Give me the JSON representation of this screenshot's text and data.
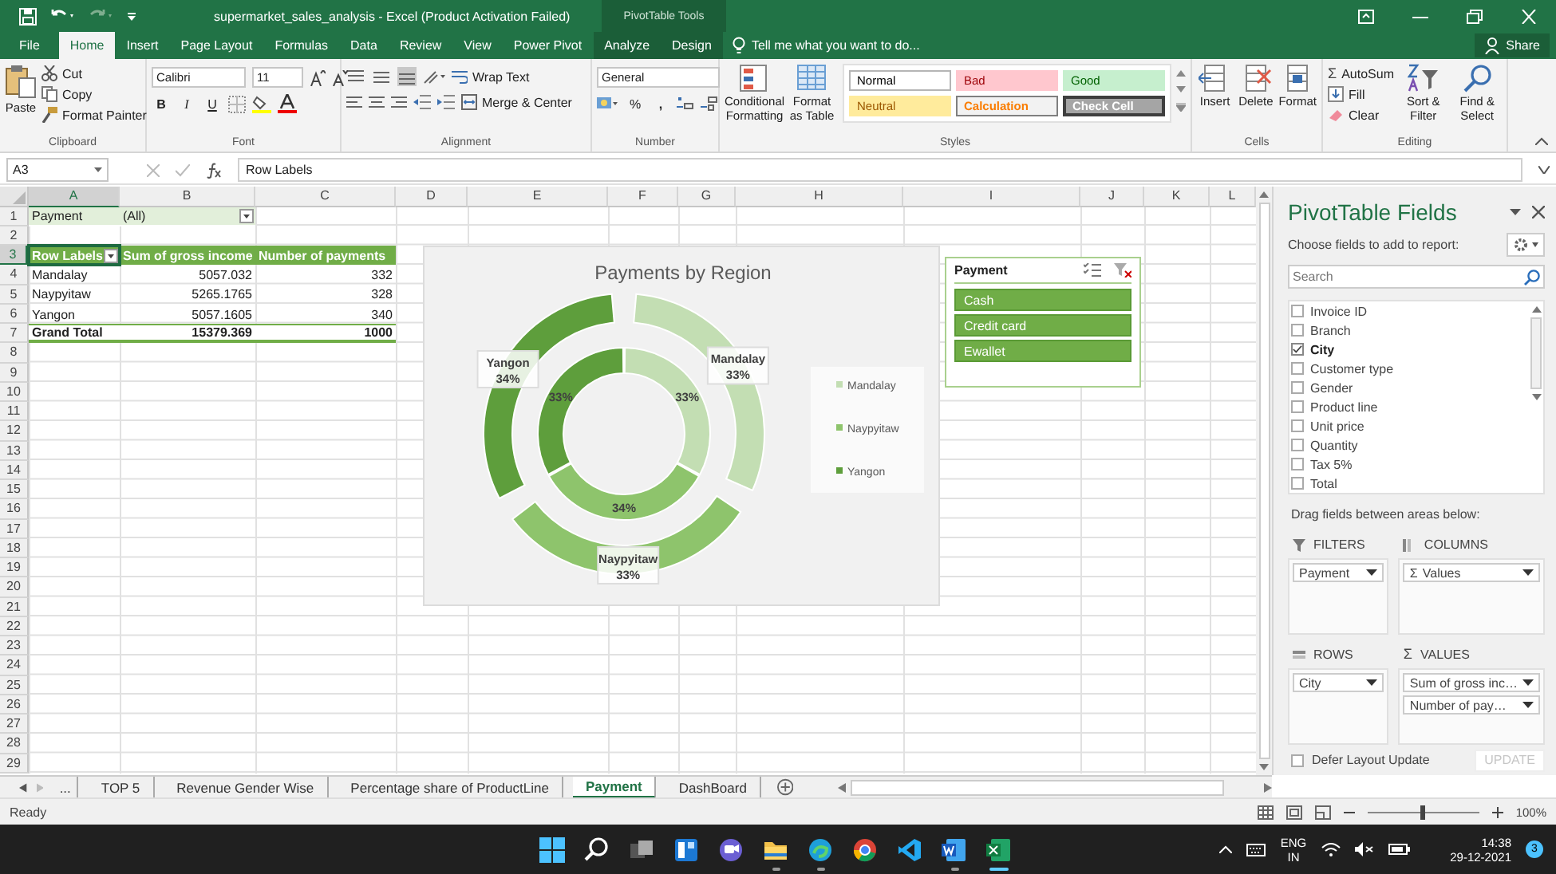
{
  "window": {
    "title": "supermarket_sales_analysis - Excel (Product Activation Failed)",
    "context_group": "PivotTable Tools"
  },
  "tabs": [
    {
      "label": "File",
      "selected": false,
      "contextual": false
    },
    {
      "label": "Home",
      "selected": true,
      "contextual": false
    },
    {
      "label": "Insert",
      "selected": false,
      "contextual": false
    },
    {
      "label": "Page Layout",
      "selected": false,
      "contextual": false
    },
    {
      "label": "Formulas",
      "selected": false,
      "contextual": false
    },
    {
      "label": "Data",
      "selected": false,
      "contextual": false
    },
    {
      "label": "Review",
      "selected": false,
      "contextual": false
    },
    {
      "label": "View",
      "selected": false,
      "contextual": false
    },
    {
      "label": "Power Pivot",
      "selected": false,
      "contextual": false
    },
    {
      "label": "Analyze",
      "selected": false,
      "contextual": true
    },
    {
      "label": "Design",
      "selected": false,
      "contextual": true
    }
  ],
  "tell_me": {
    "placeholder": "Tell me what you want to do..."
  },
  "share": "Share",
  "ribbon": {
    "clipboard": {
      "label": "Clipboard",
      "paste": "Paste",
      "cut": "Cut",
      "copy": "Copy",
      "format_painter": "Format Painter"
    },
    "font": {
      "label": "Font",
      "name": "Calibri",
      "size": "11",
      "bold": "B",
      "italic": "I",
      "underline": "U"
    },
    "alignment": {
      "label": "Alignment",
      "wrap_text": "Wrap Text",
      "merge_center": "Merge & Center",
      "vertical_align": [
        {
          "selected": false
        },
        {
          "selected": false
        },
        {
          "selected": true
        }
      ]
    },
    "number": {
      "label": "Number",
      "format": "General",
      "percent": "%",
      "comma": ","
    },
    "styles": {
      "label": "Styles",
      "conditional_formatting": "Conditional Formatting",
      "format_as_table": "Format as Table",
      "cell_styles": [
        {
          "label": "Normal",
          "kind": "normal"
        },
        {
          "label": "Bad",
          "kind": "bad"
        },
        {
          "label": "Good",
          "kind": "good"
        },
        {
          "label": "Neutral",
          "kind": "neutral"
        },
        {
          "label": "Calculation",
          "kind": "calculation"
        },
        {
          "label": "Check Cell",
          "kind": "check"
        }
      ]
    },
    "cells": {
      "label": "Cells",
      "buttons": [
        "Insert",
        "Delete",
        "Format"
      ]
    },
    "editing": {
      "label": "Editing",
      "sigma": "Σ",
      "autosum": "AutoSum",
      "fill": "Fill",
      "clear": "Clear",
      "sort_filter": "Sort & Filter",
      "find_select": "Find & Select"
    }
  },
  "formula_bar": {
    "name_box": "A3",
    "formula": "Row Labels"
  },
  "sheet": {
    "columns": [
      {
        "label": "A",
        "selected": true
      },
      {
        "label": "B",
        "selected": false
      },
      {
        "label": "C",
        "selected": false
      },
      {
        "label": "D",
        "selected": false
      },
      {
        "label": "E",
        "selected": false
      },
      {
        "label": "F",
        "selected": false
      },
      {
        "label": "G",
        "selected": false
      },
      {
        "label": "H",
        "selected": false
      },
      {
        "label": "I",
        "selected": false
      },
      {
        "label": "J",
        "selected": false
      },
      {
        "label": "K",
        "selected": false
      },
      {
        "label": "L",
        "selected": false
      }
    ],
    "rows": [
      {
        "label": "1",
        "selected": false
      },
      {
        "label": "2",
        "selected": false
      },
      {
        "label": "3",
        "selected": true
      },
      {
        "label": "4",
        "selected": false
      },
      {
        "label": "5",
        "selected": false
      },
      {
        "label": "6",
        "selected": false
      },
      {
        "label": "7",
        "selected": false
      },
      {
        "label": "8",
        "selected": false
      },
      {
        "label": "9",
        "selected": false
      },
      {
        "label": "10",
        "selected": false
      },
      {
        "label": "11",
        "selected": false
      },
      {
        "label": "12",
        "selected": false
      },
      {
        "label": "13",
        "selected": false
      },
      {
        "label": "14",
        "selected": false
      },
      {
        "label": "15",
        "selected": false
      },
      {
        "label": "16",
        "selected": false
      },
      {
        "label": "17",
        "selected": false
      },
      {
        "label": "18",
        "selected": false
      },
      {
        "label": "19",
        "selected": false
      },
      {
        "label": "20",
        "selected": false
      },
      {
        "label": "21",
        "selected": false
      },
      {
        "label": "22",
        "selected": false
      },
      {
        "label": "23",
        "selected": false
      },
      {
        "label": "24",
        "selected": false
      },
      {
        "label": "25",
        "selected": false
      },
      {
        "label": "26",
        "selected": false
      },
      {
        "label": "27",
        "selected": false
      },
      {
        "label": "28",
        "selected": false
      },
      {
        "label": "29",
        "selected": false
      }
    ]
  },
  "pivot": {
    "filter": {
      "label": "Payment",
      "value": "(All)"
    },
    "header": [
      "Row Labels",
      "Sum of gross income",
      "Number of payments"
    ],
    "rows": [
      [
        "Mandalay",
        "5057.032",
        "332"
      ],
      [
        "Naypyitaw",
        "5265.1765",
        "328"
      ],
      [
        "Yangon",
        "5057.1605",
        "340"
      ]
    ],
    "total": [
      "Grand Total",
      "15379.369",
      "1000"
    ]
  },
  "chart": {
    "chart_data": {
      "type": "donut",
      "title": "Payments by Region",
      "categories": [
        "Mandalay",
        "Naypyitaw",
        "Yangon"
      ],
      "colors": [
        "#c3deb3",
        "#8ec46c",
        "#5e9e3c"
      ],
      "data_labels": true,
      "series": [
        {
          "values": [
            33,
            33,
            34
          ],
          "value_labels": [
            "33%",
            "33%",
            "34%"
          ]
        },
        {
          "values": [
            33,
            34,
            33
          ],
          "value_labels": [
            "33%",
            "34%",
            "33%"
          ]
        }
      ]
    },
    "legend": [
      {
        "label": "Mandalay",
        "color": "#c3deb3"
      },
      {
        "label": "Naypyitaw",
        "color": "#8ec46c"
      },
      {
        "label": "Yangon",
        "color": "#5e9e3c"
      }
    ]
  },
  "slicer": {
    "title": "Payment",
    "items": [
      {
        "label": "Cash",
        "selected": true
      },
      {
        "label": "Credit card",
        "selected": true
      },
      {
        "label": "Ewallet",
        "selected": true
      }
    ]
  },
  "pane": {
    "title": "PivotTable Fields",
    "subtitle": "Choose fields to add to report:",
    "search": {
      "placeholder": "Search"
    },
    "fields": [
      {
        "label": "Invoice ID",
        "checked": false
      },
      {
        "label": "Branch",
        "checked": false
      },
      {
        "label": "City",
        "checked": true
      },
      {
        "label": "Customer type",
        "checked": false
      },
      {
        "label": "Gender",
        "checked": false
      },
      {
        "label": "Product line",
        "checked": false
      },
      {
        "label": "Unit price",
        "checked": false
      },
      {
        "label": "Quantity",
        "checked": false
      },
      {
        "label": "Tax 5%",
        "checked": false
      },
      {
        "label": "Total",
        "checked": false
      }
    ],
    "areas_hint": "Drag fields between areas below:",
    "areas": [
      {
        "kind": "filters",
        "title": "FILTERS",
        "items": [
          {
            "label": "Payment"
          }
        ]
      },
      {
        "kind": "columns",
        "title": "COLUMNS",
        "items": [
          {
            "symbol": "Σ",
            "label": "Values"
          }
        ]
      },
      {
        "kind": "rows",
        "title": "ROWS",
        "items": [
          {
            "label": "City"
          }
        ]
      },
      {
        "kind": "values",
        "symbol": "Σ",
        "title": "VALUES",
        "items": [
          {
            "label": "Sum of gross inc…"
          },
          {
            "label": "Number of pay…"
          }
        ]
      }
    ],
    "defer": {
      "label": "Defer Layout Update",
      "checked": false
    },
    "update": {
      "label": "UPDATE",
      "disabled": true
    }
  },
  "sheet_tabs": {
    "more": "...",
    "tabs": [
      {
        "label": "TOP 5",
        "selected": false
      },
      {
        "label": "Revenue Gender Wise",
        "selected": false
      },
      {
        "label": "Percentage share of ProductLine",
        "selected": false
      },
      {
        "label": "Payment",
        "selected": true
      },
      {
        "label": "DashBoard",
        "selected": false
      }
    ]
  },
  "status_bar": {
    "text": "Ready",
    "zoom": "100%",
    "zoom_level": {
      "level": 0.5
    }
  },
  "taskbar": {
    "apps": [
      {
        "kind": "start",
        "running": false
      },
      {
        "kind": "search",
        "running": false
      },
      {
        "kind": "taskview",
        "running": false
      },
      {
        "kind": "widgets",
        "running": false
      },
      {
        "kind": "chat",
        "running": false
      },
      {
        "kind": "files",
        "running": true
      },
      {
        "kind": "edge",
        "running": true
      },
      {
        "kind": "chrome",
        "running": false
      },
      {
        "kind": "vscode",
        "running": false
      },
      {
        "kind": "word",
        "running": true
      },
      {
        "kind": "excel",
        "running": true
      }
    ],
    "language": "ENG",
    "region": "IN",
    "time": "14:38",
    "date": "29-12-2021",
    "notifications": "3"
  }
}
